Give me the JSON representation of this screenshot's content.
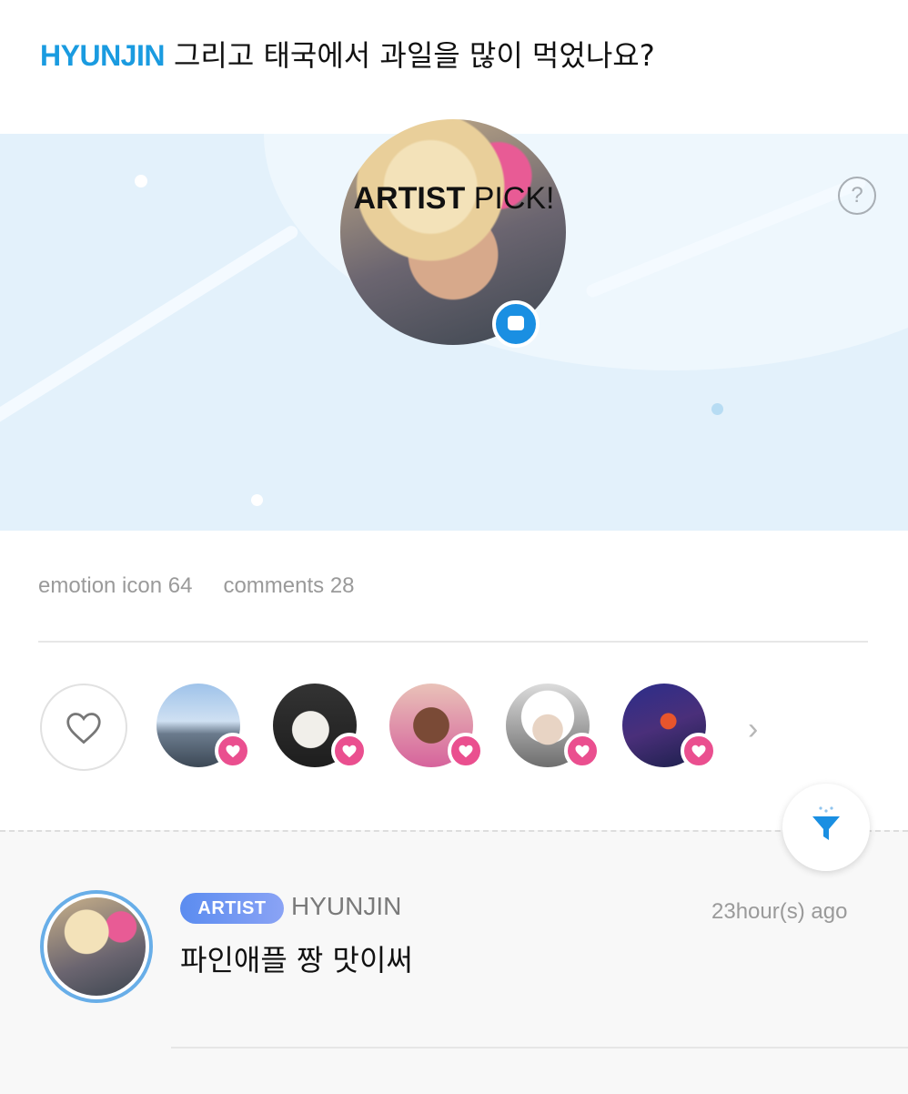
{
  "post": {
    "author": "HYUNJIN",
    "text": "그리고 태국에서 과일을 많이 먹었나요?"
  },
  "artist_pick": {
    "title_bold": "ARTIST",
    "title_rest": "PICK!",
    "help_icon": "question-circle-icon",
    "help_glyph": "?",
    "badge_icon": "speech-bubble-icon"
  },
  "stats": {
    "emotion": "emotion icon 64",
    "comments": "comments 28"
  },
  "reactors": {
    "like_icon": "heart-outline-icon",
    "more_icon": "chevron-right-icon",
    "more_glyph": "›",
    "badge_icon": "heart-icon"
  },
  "filter": {
    "icon": "filter-icon"
  },
  "comment": {
    "badge": "ARTIST",
    "name": "HYUNJIN",
    "time": "23hour(s) ago",
    "text": "파인애플 짱 맛이써"
  },
  "colors": {
    "accent": "#1a9be0",
    "banner_bg": "#e3f1fb",
    "heart_badge": "#ea4f8f",
    "artist_badge": "#6f95f2"
  }
}
